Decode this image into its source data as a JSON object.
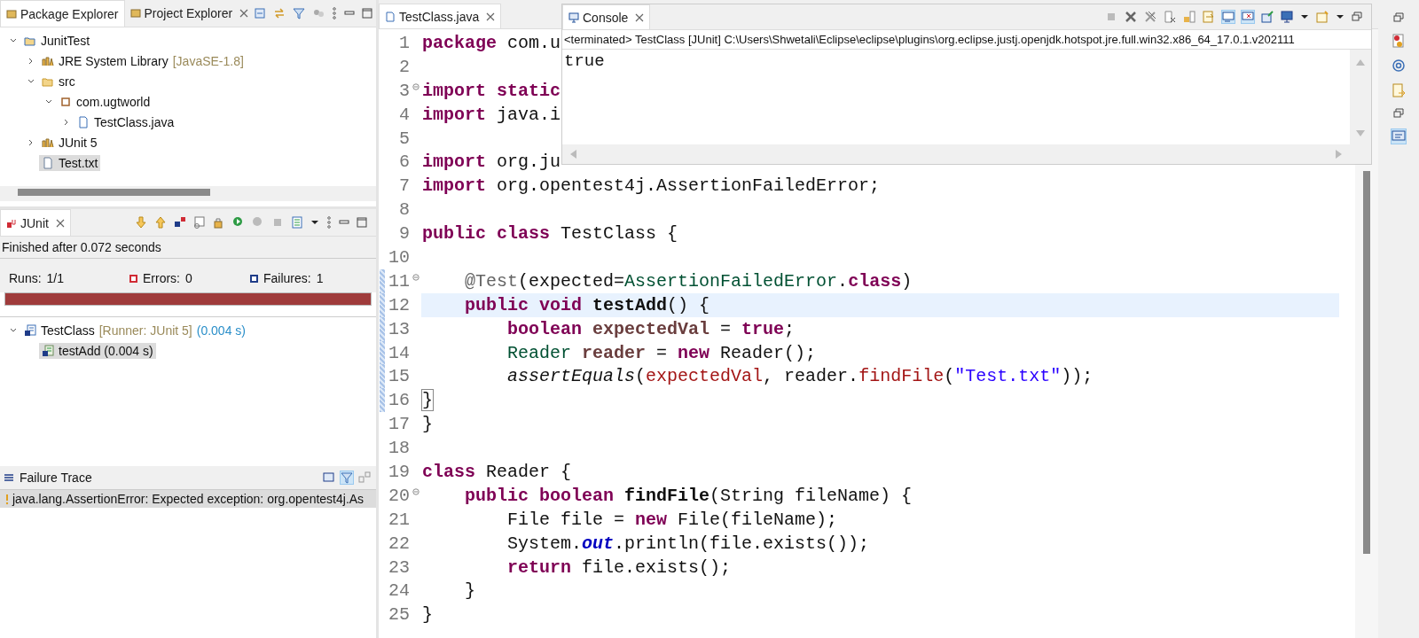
{
  "package_explorer": {
    "tabs": [
      {
        "label": "Package Explorer",
        "selected": true,
        "closable": false
      },
      {
        "label": "Project Explorer",
        "selected": false,
        "closable": true
      }
    ],
    "tree": [
      {
        "label": "JunitTest",
        "kind": "project",
        "expanded": true,
        "selected": false,
        "children": [
          {
            "label": "JRE System Library",
            "decoration": "[JavaSE-1.8]",
            "kind": "library",
            "expanded": false,
            "selected": false
          },
          {
            "label": "src",
            "kind": "folder",
            "expanded": true,
            "selected": false,
            "children": [
              {
                "label": "com.ugtworld",
                "kind": "package",
                "expanded": true,
                "selected": false,
                "children": [
                  {
                    "label": "TestClass.java",
                    "kind": "java-file",
                    "expanded": false,
                    "selected": false
                  }
                ]
              }
            ]
          },
          {
            "label": "JUnit 5",
            "kind": "library",
            "expanded": false,
            "selected": false
          },
          {
            "label": "Test.txt",
            "kind": "text-file",
            "selected": true
          }
        ]
      }
    ]
  },
  "junit": {
    "tab": "JUnit",
    "status": "Finished after 0.072 seconds",
    "counters": [
      {
        "label": "Runs:",
        "value": "1/1",
        "kind": "runs"
      },
      {
        "label": "Errors:",
        "value": "0",
        "kind": "errors"
      },
      {
        "label": "Failures:",
        "value": "1",
        "kind": "failures"
      }
    ],
    "progress": {
      "level": 1,
      "failed": true
    },
    "tree": [
      {
        "label": "TestClass",
        "decoration": "[Runner: JUnit 5]",
        "time": "(0.004 s)",
        "kind": "suite",
        "expanded": true,
        "selected": false,
        "children": [
          {
            "label": "testAdd (0.004 s)",
            "kind": "test",
            "selected": true
          }
        ]
      }
    ],
    "failure_trace": {
      "title": "Failure Trace",
      "lines": [
        {
          "text": "java.lang.AssertionError: Expected exception: org.opentest4j.As",
          "selected": true
        }
      ]
    }
  },
  "editor": {
    "tab": "TestClass.java",
    "lines": [
      {
        "number": "1",
        "segments": [
          {
            "kind": "keyword",
            "text": "package"
          },
          {
            "kind": "plain",
            "text": " com.u"
          }
        ]
      },
      {
        "number": "2"
      },
      {
        "number": "3",
        "fold": true,
        "segments": [
          {
            "kind": "keyword",
            "text": "import static"
          }
        ]
      },
      {
        "number": "4",
        "segments": [
          {
            "kind": "keyword",
            "text": "import"
          },
          {
            "kind": "plain",
            "text": " java.i"
          }
        ]
      },
      {
        "number": "5"
      },
      {
        "number": "6",
        "segments": [
          {
            "kind": "keyword",
            "text": "import"
          },
          {
            "kind": "plain",
            "text": " org.ju"
          }
        ]
      },
      {
        "number": "7",
        "segments": [
          {
            "kind": "keyword",
            "text": "import"
          },
          {
            "kind": "plain",
            "text": " org.opentest4j.AssertionFailedError;"
          }
        ]
      },
      {
        "number": "8"
      },
      {
        "number": "9",
        "segments": [
          {
            "kind": "keyword",
            "text": "public class"
          },
          {
            "kind": "plain",
            "text": " TestClass {"
          }
        ]
      },
      {
        "number": "10"
      },
      {
        "number": "11",
        "fold": true,
        "changed": true,
        "segments": [
          {
            "kind": "annotation",
            "text": "    @Test"
          },
          {
            "kind": "plain",
            "text": "(expected="
          },
          {
            "kind": "type",
            "text": "AssertionFailedError"
          },
          {
            "kind": "plain",
            "text": "."
          },
          {
            "kind": "keyword",
            "text": "class"
          },
          {
            "kind": "plain",
            "text": ")"
          }
        ]
      },
      {
        "number": "12",
        "current": true,
        "changed": true,
        "segments": [
          {
            "kind": "keyword",
            "text": "    public void"
          },
          {
            "kind": "method",
            "text": " testAdd"
          },
          {
            "kind": "plain",
            "text": "() {"
          }
        ]
      },
      {
        "number": "13",
        "changed": true,
        "segments": [
          {
            "kind": "keyword",
            "text": "        boolean"
          },
          {
            "kind": "local-decl",
            "text": " expectedVal"
          },
          {
            "kind": "plain",
            "text": " = "
          },
          {
            "kind": "keyword",
            "text": "true"
          },
          {
            "kind": "plain",
            "text": ";"
          }
        ]
      },
      {
        "number": "14",
        "changed": true,
        "segments": [
          {
            "kind": "type",
            "text": "        Reader"
          },
          {
            "kind": "local-decl",
            "text": " reader"
          },
          {
            "kind": "plain",
            "text": " = "
          },
          {
            "kind": "keyword",
            "text": "new"
          },
          {
            "kind": "plain",
            "text": " Reader();"
          }
        ]
      },
      {
        "number": "15",
        "changed": true,
        "segments": [
          {
            "kind": "static",
            "text": "        assertEquals"
          },
          {
            "kind": "plain",
            "text": "("
          },
          {
            "kind": "local",
            "text": "expectedVal"
          },
          {
            "kind": "plain",
            "text": ", reader."
          },
          {
            "kind": "local",
            "text": "findFile"
          },
          {
            "kind": "plain",
            "text": "("
          },
          {
            "kind": "string",
            "text": "\"Test.txt\""
          },
          {
            "kind": "plain",
            "text": "));"
          }
        ]
      },
      {
        "number": "16",
        "changed": true,
        "segments": [
          {
            "kind": "bracket",
            "text": "}"
          }
        ]
      },
      {
        "number": "17",
        "segments": [
          {
            "kind": "plain",
            "text": "}"
          }
        ]
      },
      {
        "number": "18"
      },
      {
        "number": "19",
        "segments": [
          {
            "kind": "keyword",
            "text": "class"
          },
          {
            "kind": "plain",
            "text": " Reader {"
          }
        ]
      },
      {
        "number": "20",
        "fold": true,
        "segments": [
          {
            "kind": "keyword",
            "text": "    public boolean"
          },
          {
            "kind": "method",
            "text": " findFile"
          },
          {
            "kind": "plain",
            "text": "(String fileName) {"
          }
        ]
      },
      {
        "number": "21",
        "segments": [
          {
            "kind": "plain",
            "text": "        File file = "
          },
          {
            "kind": "keyword",
            "text": "new"
          },
          {
            "kind": "plain",
            "text": " File(fileName);"
          }
        ]
      },
      {
        "number": "22",
        "segments": [
          {
            "kind": "plain",
            "text": "        System."
          },
          {
            "kind": "static-field",
            "text": "out"
          },
          {
            "kind": "plain",
            "text": ".println(file.exists());"
          }
        ]
      },
      {
        "number": "23",
        "segments": [
          {
            "kind": "keyword",
            "text": "        return"
          },
          {
            "kind": "plain",
            "text": " file.exists();"
          }
        ]
      },
      {
        "number": "24",
        "segments": [
          {
            "kind": "plain",
            "text": "    }"
          }
        ]
      },
      {
        "number": "25",
        "segments": [
          {
            "kind": "plain",
            "text": "}"
          }
        ]
      }
    ]
  },
  "console": {
    "tab": "Console",
    "header": "<terminated> TestClass [JUnit] C:\\Users\\Shwetali\\Eclipse\\eclipse\\plugins\\org.eclipse.justj.openjdk.hotspot.jre.full.win32.x86_64_17.0.1.v202111",
    "output": [
      "true"
    ]
  }
}
